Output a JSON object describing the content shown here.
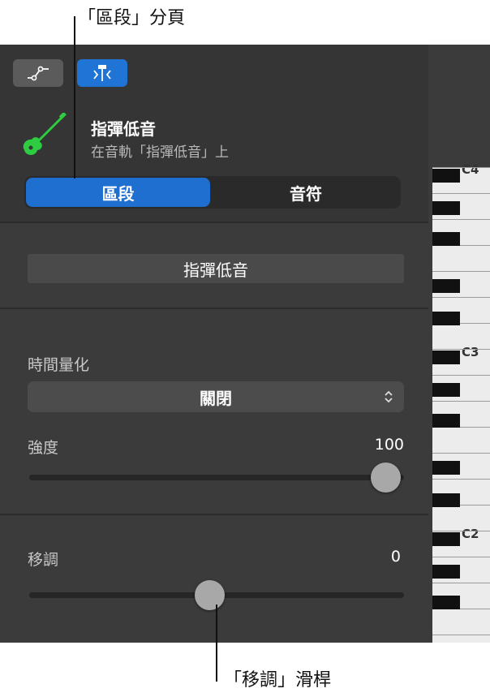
{
  "callouts": {
    "region_tab": "「區段」分頁",
    "transpose_slider": "「移調」滑桿"
  },
  "toolbar": {
    "automation_icon": "automation-curve-icon",
    "smart_controls_icon": "smart-controls-icon"
  },
  "track": {
    "icon": "bass-guitar-icon",
    "name": "指彈低音",
    "subtitle": "在音軌「指彈低音」上"
  },
  "tabs": {
    "region": "區段",
    "notes": "音符",
    "active": "region"
  },
  "region": {
    "name": "指彈低音"
  },
  "time_quantize": {
    "label": "時間量化",
    "value": "關閉"
  },
  "velocity": {
    "label": "強度",
    "value": "100",
    "fraction": 1.0
  },
  "transpose": {
    "label": "移調",
    "value": "0",
    "fraction": 0.5
  },
  "keyboard": {
    "labels": [
      "C4",
      "C3",
      "C2"
    ]
  },
  "colors": {
    "accent": "#1f6fd1",
    "panel": "#3b3b3b",
    "track_icon": "#2ecc40"
  }
}
